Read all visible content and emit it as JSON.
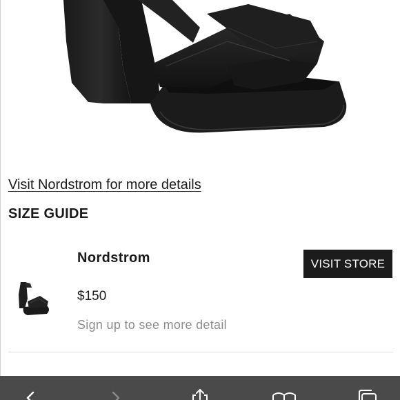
{
  "product": {
    "image_label": "black platform heeled sandal",
    "more_details_link": "Visit Nordstrom for more details"
  },
  "size_guide": {
    "heading": "SIZE GUIDE"
  },
  "store": {
    "name": "Nordstrom",
    "button_label": "VISIT STORE",
    "price": "$150",
    "signup_text": "Sign up to see more detail"
  },
  "browser_toolbar": {
    "buttons": [
      {
        "name": "back",
        "icon": "chevron-left-icon"
      },
      {
        "name": "forward",
        "icon": "chevron-right-icon"
      },
      {
        "name": "share",
        "icon": "share-icon"
      },
      {
        "name": "bookmarks",
        "icon": "book-icon"
      },
      {
        "name": "tabs",
        "icon": "tabs-icon"
      }
    ]
  },
  "colors": {
    "button_bg": "#1c1c1c",
    "toolbar_bg": "#4a4a4a",
    "muted_text": "#8c8c8c",
    "shoe": "#1e1e1e"
  }
}
